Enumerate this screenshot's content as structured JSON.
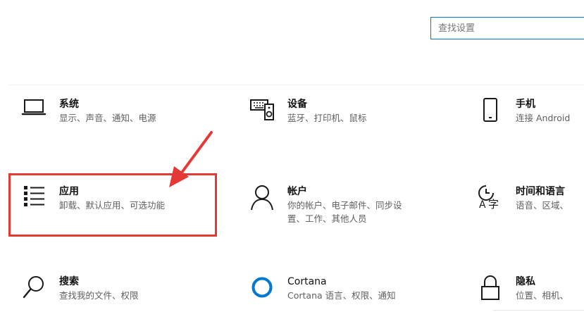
{
  "search": {
    "placeholder": "查找设置"
  },
  "tiles": [
    {
      "title": "系统",
      "desc": "显示、声音、通知、电源",
      "icon": "laptop-icon"
    },
    {
      "title": "设备",
      "desc": "蓝牙、打印机、鼠标",
      "icon": "keyboard-speaker-icon"
    },
    {
      "title": "手机",
      "desc": "连接 Android",
      "icon": "phone-icon"
    },
    {
      "title": "应用",
      "desc": "卸载、默认应用、可选功能",
      "icon": "apps-list-icon"
    },
    {
      "title": "帐户",
      "desc": "你的帐户、电子邮件、同步设\n置、工作、其他人员",
      "icon": "person-icon"
    },
    {
      "title": "时间和语言",
      "desc": "语音、区域、",
      "icon": "time-language-icon"
    },
    {
      "title": "搜索",
      "desc": "查找我的文件、权限",
      "icon": "search-icon"
    },
    {
      "title": "Cortana",
      "desc": "Cortana 语言、权限、通知",
      "icon": "cortana-icon"
    },
    {
      "title": "隐私",
      "desc": "位置、相机、",
      "icon": "lock-icon"
    }
  ],
  "colors": {
    "accent": "#0078d4",
    "annotation": "#e53935"
  }
}
